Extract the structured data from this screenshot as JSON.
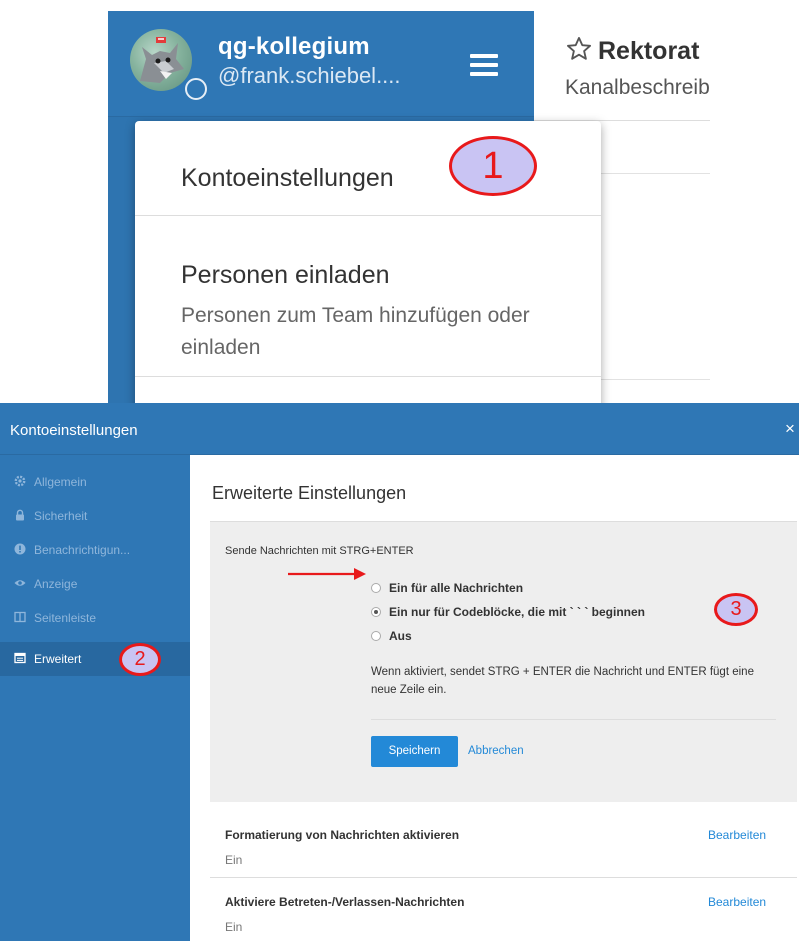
{
  "top_screenshot": {
    "sidebar": {
      "team_name": "qg-kollegium",
      "username": "@frank.schiebel...."
    },
    "channel_header": {
      "channel_name": "Rektorat",
      "description": "Kanalbeschreibung"
    },
    "dropdown": {
      "items": [
        {
          "label": "Kontoeinstellungen"
        },
        {
          "label": "Personen einladen",
          "description": "Personen zum Team hinzufügen oder einladen"
        }
      ]
    }
  },
  "annotations": {
    "step1": "1",
    "step2": "2",
    "step3": "3",
    "color": "#e8191b",
    "fill": "#c9c4f3"
  },
  "modal": {
    "title": "Kontoeinstellungen",
    "close_label": "×",
    "nav": [
      {
        "label": "Allgemein",
        "icon": "gear-icon"
      },
      {
        "label": "Sicherheit",
        "icon": "lock-icon"
      },
      {
        "label": "Benachrichtigun...",
        "icon": "exclamation-circle-icon"
      },
      {
        "label": "Anzeige",
        "icon": "eye-icon"
      },
      {
        "label": "Seitenleiste",
        "icon": "columns-icon"
      },
      {
        "label": "Erweitert",
        "icon": "list-window-icon",
        "active": true
      }
    ],
    "pane_title": "Erweiterte Einstellungen",
    "ctrl_send": {
      "title": "Sende Nachrichten mit STRG+ENTER",
      "options": [
        {
          "label": "Ein für alle Nachrichten",
          "checked": false
        },
        {
          "label": "Ein nur für Codeblöcke, die mit ` ` ` beginnen",
          "checked": true
        },
        {
          "label": "Aus",
          "checked": false
        }
      ],
      "help": "Wenn aktiviert, sendet STRG + ENTER die Nachricht und ENTER fügt eine neue Zeile ein.",
      "save_label": "Speichern",
      "cancel_label": "Abbrechen"
    },
    "settings": [
      {
        "title": "Formatierung von Nachrichten aktivieren",
        "value": "Ein",
        "edit_label": "Bearbeiten"
      },
      {
        "title": "Aktiviere Betreten-/Verlassen-Nachrichten",
        "value": "Ein",
        "edit_label": "Bearbeiten"
      }
    ]
  },
  "colors": {
    "sidebar_blue": "#2f77b5",
    "accent": "#2389d7",
    "annotation_red": "#e8191b"
  }
}
